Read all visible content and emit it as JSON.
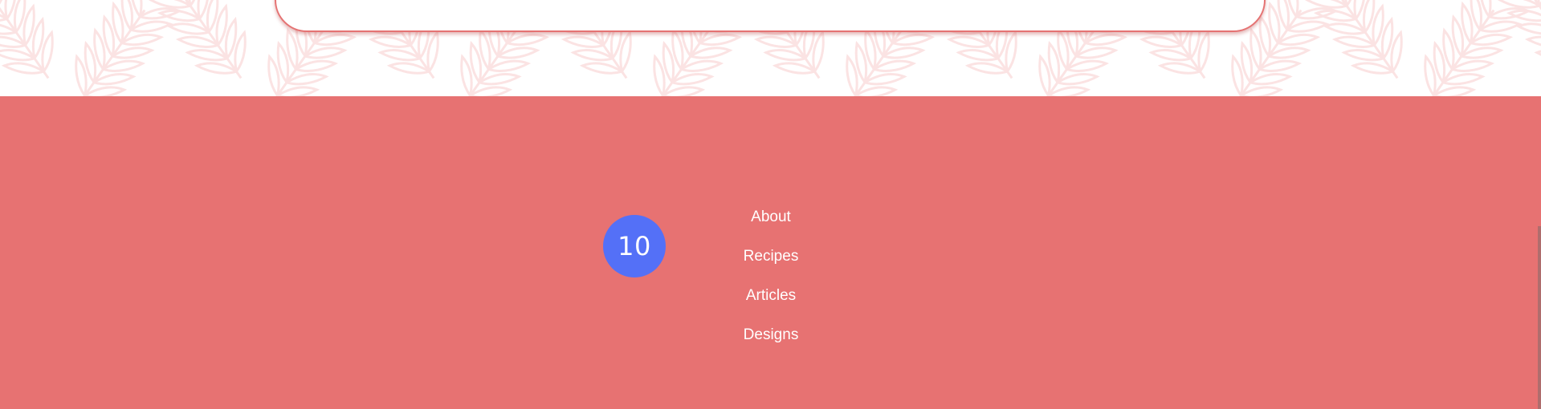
{
  "footer": {
    "badge_text": "10",
    "nav": [
      {
        "label": "About"
      },
      {
        "label": "Recipes"
      },
      {
        "label": "Articles"
      },
      {
        "label": "Designs"
      }
    ]
  },
  "colors": {
    "footer_bg": "#e77272",
    "badge_bg": "#5470f7",
    "card_border": "#e57373",
    "pattern_leaf": "#fbe3e3"
  },
  "icons": {
    "pattern": "leaf-pattern-icon"
  }
}
